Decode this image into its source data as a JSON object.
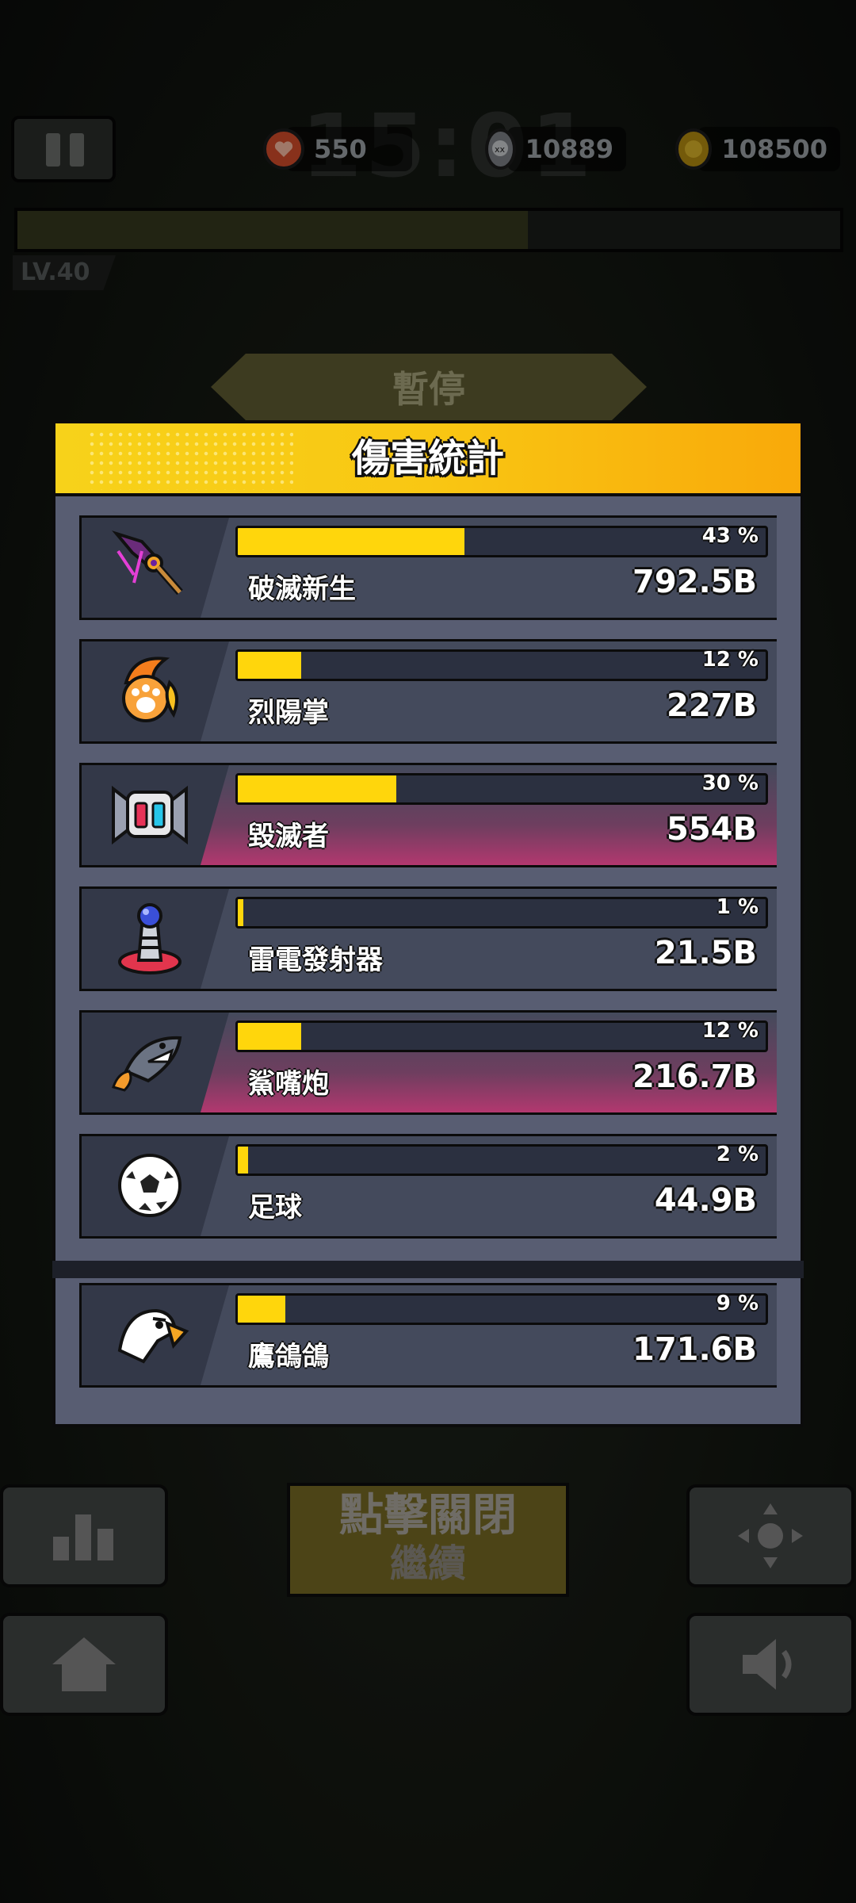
{
  "hud": {
    "timer": "15:01",
    "hearts": "550",
    "kills": "10889",
    "coins": "108500",
    "level": "LV.40",
    "xp_fill": 0.62
  },
  "paused_label": "暫停",
  "panel": {
    "title": "傷害統計",
    "rows": [
      {
        "name": "破滅新生",
        "percent": "43 %",
        "value": "792.5B",
        "fill": 43,
        "icon": "cursed-sword-icon"
      },
      {
        "name": "烈陽掌",
        "percent": "12 %",
        "value": "227B",
        "fill": 12,
        "icon": "sun-paw-icon"
      },
      {
        "name": "毀滅者",
        "percent": "30 %",
        "value": "554B",
        "fill": 30,
        "icon": "destroyer-robot-icon"
      },
      {
        "name": "雷電發射器",
        "percent": "1 %",
        "value": "21.5B",
        "fill": 1,
        "icon": "tesla-coil-icon"
      },
      {
        "name": "鯊嘴炮",
        "percent": "12 %",
        "value": "216.7B",
        "fill": 12,
        "icon": "shark-rocket-icon"
      },
      {
        "name": "足球",
        "percent": "2 %",
        "value": "44.9B",
        "fill": 2,
        "icon": "soccer-ball-icon"
      }
    ],
    "summon_row": {
      "name": "鷹鴿鴿",
      "percent": "9 %",
      "value": "171.6B",
      "fill": 9,
      "icon": "eagle-icon"
    }
  },
  "close_button": {
    "line1": "點擊關閉",
    "line2": "繼續"
  },
  "colors": {
    "accent": "#ffd60c",
    "panel": "#585d72",
    "row": "#333848"
  }
}
